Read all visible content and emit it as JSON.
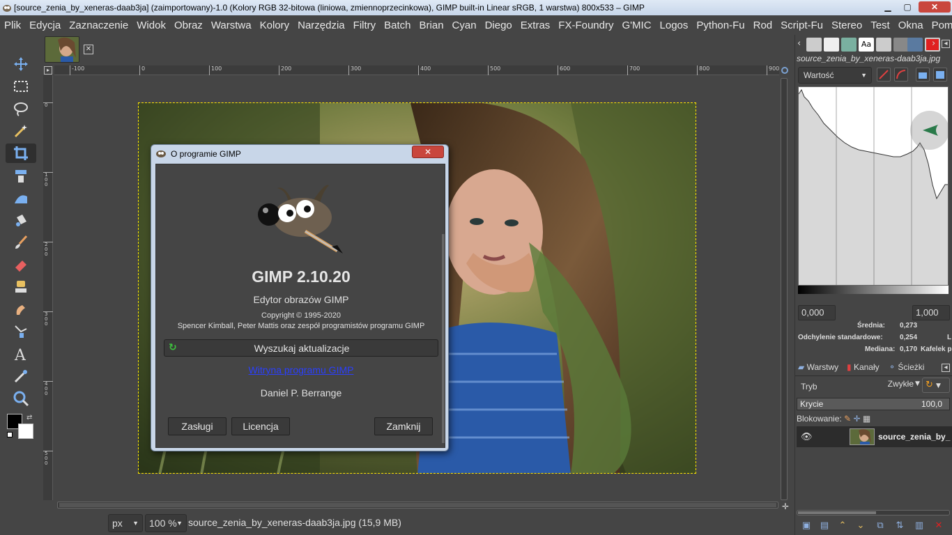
{
  "window": {
    "title": "[source_zenia_by_xeneras-daab3ja] (zaimportowany)-1.0 (Kolory RGB 32-bitowa (liniowa, zmiennoprzecinkowa), GIMP built-in Linear sRGB, 1 warstwa) 800x533 – GIMP",
    "minimize": "▁",
    "maximize": "▢",
    "close": "✕"
  },
  "menu": [
    "Plik",
    "Edycja",
    "Zaznaczenie",
    "Widok",
    "Obraz",
    "Warstwa",
    "Kolory",
    "Narzędzia",
    "Filtry",
    "Batch",
    "Brian",
    "Cyan",
    "Diego",
    "Extras",
    "FX-Foundry",
    "G'MIC",
    "Logos",
    "Python-Fu",
    "Rod",
    "Script-Fu",
    "Stereo",
    "Test",
    "Okna",
    "Pomoc"
  ],
  "toolbox": {
    "tools": [
      "move-tool-icon",
      "rect-select-tool-icon",
      "free-select-tool-icon",
      "fuzzy-select-tool-icon",
      "crop-tool-icon",
      "unified-transform-tool-icon",
      "warp-transform-tool-icon",
      "bucket-fill-tool-icon",
      "paintbrush-tool-icon",
      "eraser-tool-icon",
      "clone-tool-icon",
      "smudge-tool-icon",
      "paths-tool-icon",
      "text-tool-icon",
      "color-picker-tool-icon",
      "zoom-tool-icon"
    ],
    "active_tool": "crop-tool-icon",
    "fg_color": "#000000",
    "bg_color": "#ffffff"
  },
  "ruler": {
    "h_labels": [
      "-100",
      "0",
      "100",
      "200",
      "300",
      "400",
      "500",
      "600",
      "700",
      "800",
      "900"
    ],
    "v_labels": [
      "0",
      "1\n0\n0",
      "2\n0\n0",
      "3\n0\n0",
      "4\n0\n0",
      "5\n0\n0"
    ]
  },
  "statusbar": {
    "unit": "px",
    "zoom": "100 %",
    "text": "source_zenia_by_xeneras-daab3ja.jpg (15,9 MB)"
  },
  "dock": {
    "filename": "source_zenia_by_xeneras-daab3ja.jpg",
    "histogram": {
      "channel": "Wartość",
      "min": "0,000",
      "max": "1,000",
      "mean_label": "Średnia:",
      "mean_value": "0,273",
      "std_label": "Odchylenie standardowe:",
      "std_value": "0,254",
      "median_label": "Mediana:",
      "median_value": "0,170",
      "tile_label": "Kafelek p",
      "l_label": "L"
    },
    "layers": {
      "tabs": [
        "Warstwy",
        "Kanały",
        "Ścieżki"
      ],
      "mode_label": "Tryb",
      "mode_value": "Zwykłe",
      "opacity_label": "Krycie",
      "opacity_value": "100,0",
      "lock_label": "Blokowanie:",
      "layer_name": "source_zenia_by_"
    }
  },
  "about_dialog": {
    "title": "O programie GIMP",
    "close": "✕",
    "app_name": "GIMP 2.10.20",
    "subtitle": "Edytor obrazów GIMP",
    "copyright": "Copyright © 1995-2020",
    "authors": "Spencer Kimball, Peter Mattis oraz zespół programistów programu GIMP",
    "update_button": "Wyszukaj aktualizacje",
    "website_link": "Witryna programu GIMP",
    "rotating_author": "Daniel P. Berrange",
    "credits_button": "Zasługi",
    "license_button": "Licencja",
    "close_button": "Zamknij"
  }
}
